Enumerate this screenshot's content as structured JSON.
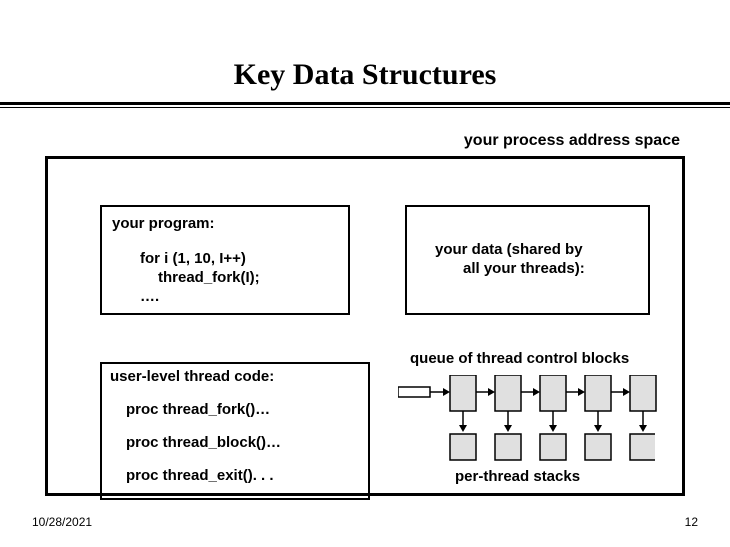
{
  "slide": {
    "title": "Key Data Structures"
  },
  "addr_space_label": "your process address space",
  "program": {
    "heading": "your program:",
    "line1": "for i (1, 10, I++)",
    "line2": "thread_fork(I);",
    "line3": "…."
  },
  "data_block": {
    "line1": "your data (shared by",
    "line2": "all your threads):"
  },
  "queue_label": "queue of thread control blocks",
  "usercode": {
    "heading": "user-level thread code:",
    "proc1": "proc thread_fork()…",
    "proc2": "proc thread_block()…",
    "proc3": "proc thread_exit(). . ."
  },
  "stacks_label": "per-thread stacks",
  "footer": {
    "date": "10/28/2021",
    "page": "12"
  },
  "colors": {
    "grey_fill": "#e0e0e0"
  }
}
